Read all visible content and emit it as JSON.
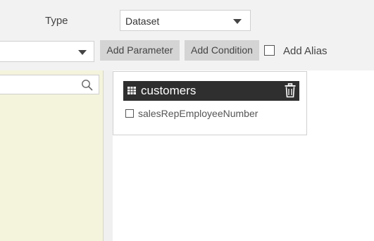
{
  "toolbar": {
    "type_label": "Type",
    "type_value": "Dataset",
    "parameter_value": "",
    "add_parameter": "Add Parameter",
    "add_condition": "Add Condition",
    "add_alias": "Add Alias",
    "add_alias_checked": false
  },
  "search": {
    "placeholder": ""
  },
  "tables": [
    {
      "name": "customers",
      "columns": [
        {
          "name": "salesRepEmployeeNumber",
          "checked": false
        }
      ]
    }
  ],
  "icons": {
    "type_dropdown": "chevron-down-icon",
    "parameter_dropdown": "chevron-down-icon",
    "search": "search-icon",
    "table": "grid-icon",
    "delete": "trash-icon"
  },
  "colors": {
    "left_panel_bg": "#f4f3dc",
    "table_header_bg": "#2f2f2f",
    "button_bg": "#d4d4d4"
  }
}
